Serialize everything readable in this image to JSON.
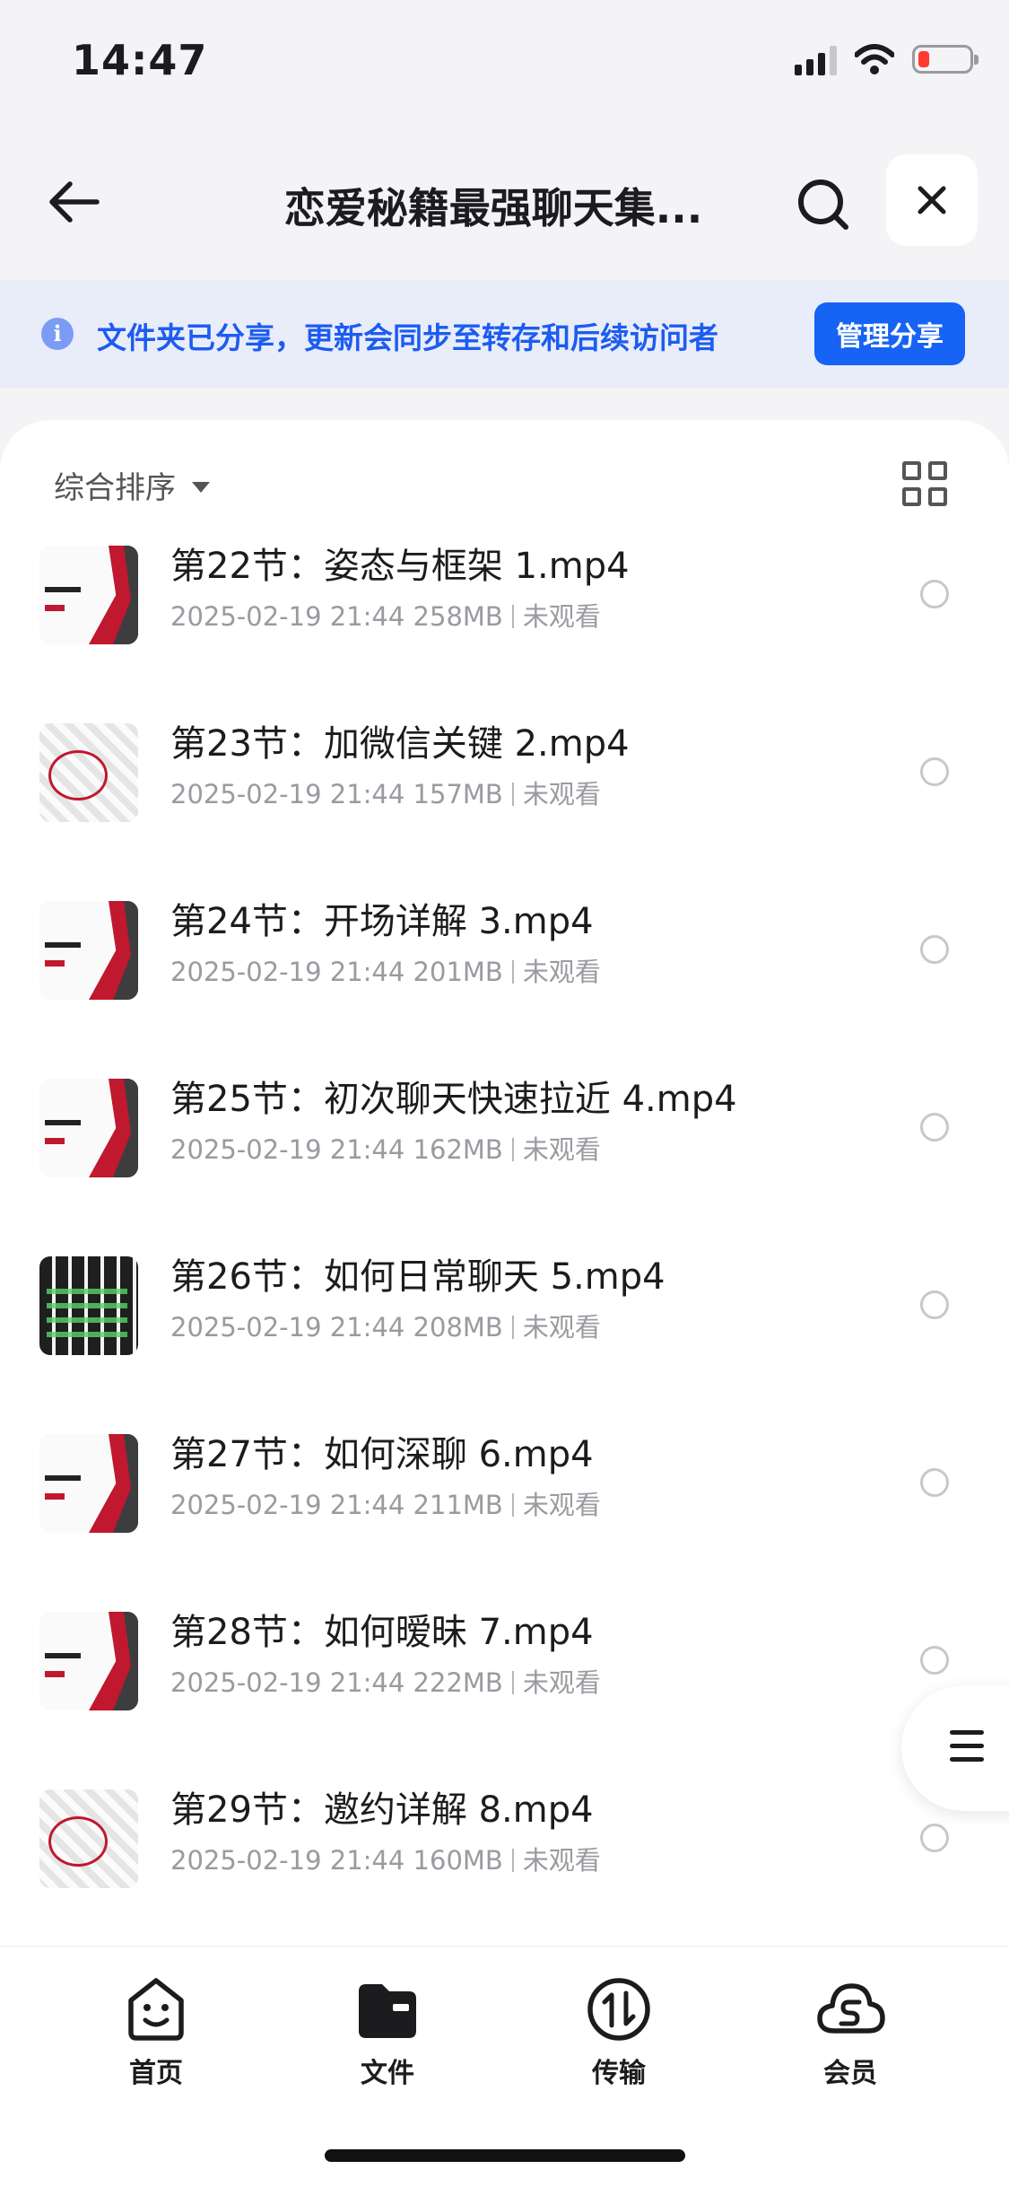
{
  "status_bar": {
    "time": "14:47"
  },
  "header": {
    "title": "恋爱秘籍最强聊天集..."
  },
  "banner": {
    "text": "文件夹已分享，更新会同步至转存和后续访问者",
    "action_label": "管理分享"
  },
  "toolbar": {
    "sort_label": "综合排序"
  },
  "files": [
    {
      "name": "第22节：姿态与框架 1.mp4",
      "date": "2025-02-19 21:44",
      "size": "258MB",
      "status": "未观看",
      "thumb": "slide"
    },
    {
      "name": "第23节：加微信关键 2.mp4",
      "date": "2025-02-19 21:44",
      "size": "157MB",
      "status": "未观看",
      "thumb": "collage"
    },
    {
      "name": "第24节：开场详解 3.mp4",
      "date": "2025-02-19 21:44",
      "size": "201MB",
      "status": "未观看",
      "thumb": "slide"
    },
    {
      "name": "第25节：初次聊天快速拉近 4.mp4",
      "date": "2025-02-19 21:44",
      "size": "162MB",
      "status": "未观看",
      "thumb": "slide"
    },
    {
      "name": "第26节：如何日常聊天 5.mp4",
      "date": "2025-02-19 21:44",
      "size": "208MB",
      "status": "未观看",
      "thumb": "chat"
    },
    {
      "name": "第27节：如何深聊 6.mp4",
      "date": "2025-02-19 21:44",
      "size": "211MB",
      "status": "未观看",
      "thumb": "slide"
    },
    {
      "name": "第28节：如何暧昧 7.mp4",
      "date": "2025-02-19 21:44",
      "size": "222MB",
      "status": "未观看",
      "thumb": "slide"
    },
    {
      "name": "第29节：邀约详解 8.mp4",
      "date": "2025-02-19 21:44",
      "size": "160MB",
      "status": "未观看",
      "thumb": "collage"
    }
  ],
  "tabs": [
    {
      "label": "首页",
      "icon": "home-smile-icon"
    },
    {
      "label": "文件",
      "icon": "folder-icon"
    },
    {
      "label": "传输",
      "icon": "transfer-icon"
    },
    {
      "label": "会员",
      "icon": "cloud-vip-icon"
    }
  ],
  "colors": {
    "accent": "#1763f5",
    "banner_bg": "#e9edfa",
    "banner_text": "#1d5cf0"
  }
}
